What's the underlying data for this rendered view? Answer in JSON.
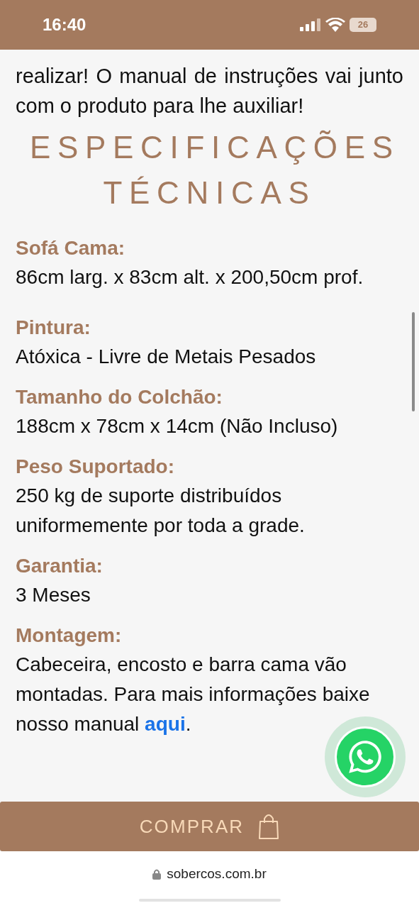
{
  "status_bar": {
    "time": "16:40",
    "battery": "26"
  },
  "intro": "realizar! O manual de instruções vai junto com o produto para lhe auxiliar!",
  "heading": "ESPECIFICAÇÕES TÉCNICAS",
  "specs": [
    {
      "label": "Sofá Cama:",
      "value": "86cm larg. x 83cm alt. x 200,50cm prof."
    },
    {
      "label": "Pintura:",
      "value": "Atóxica - Livre de Metais Pesados"
    },
    {
      "label": "Tamanho do Colchão:",
      "value": "188cm x 78cm x 14cm (Não Incluso)"
    },
    {
      "label": "Peso Suportado:",
      "value": "250 kg de suporte distribuídos uniformemente por toda a grade."
    },
    {
      "label": "Garantia:",
      "value": "3 Meses"
    },
    {
      "label": "Montagem:",
      "value": "Cabeceira, encosto e barra cama vão montadas. Para mais informações baixe nosso manual ",
      "link": "aqui",
      "after": "."
    }
  ],
  "buy_button": "COMPRAR",
  "url": "sobercos.com.br"
}
